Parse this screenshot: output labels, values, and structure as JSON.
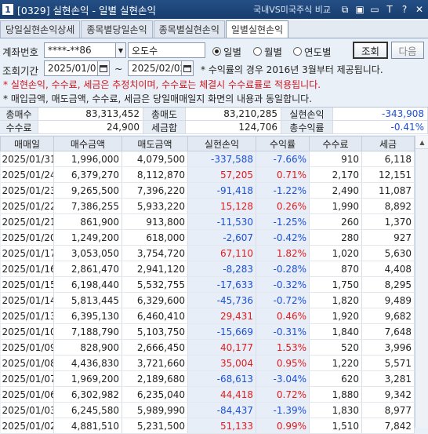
{
  "window": {
    "number": "1",
    "title": "[0329] 실현손익 - 일별 실현손익",
    "compare_link": "국내VS미국주식 비교",
    "icons": [
      "link-icon",
      "copy-icon",
      "minimize-icon",
      "font-icon",
      "help-icon",
      "close-icon"
    ],
    "icon_glyphs": [
      "⧉",
      "▣",
      "▭",
      "T",
      "?",
      "✕"
    ]
  },
  "tabs": [
    "당일실현손익상세",
    "종목별당일손익",
    "종목별실현손익",
    "일별실현손익"
  ],
  "query": {
    "account_label": "계좌번호",
    "account_value": "****-**86",
    "owner_name": "오도수",
    "radios": [
      "일별",
      "월별",
      "연도별"
    ],
    "selected_radio": "일별",
    "search_button": "조회",
    "next_button": "다음",
    "period_label": "조회기간",
    "date_from": "2025/01/01",
    "tilde": "~",
    "date_to": "2025/02/02",
    "yield_note": "* 수익률의 경우 2016년 3월부터 제공됩니다."
  },
  "notices": [
    {
      "text": "* 실현손익, 수수료, 세금은 추정치이며, 수수료는 체결시 수수료률로 적용됩니다.",
      "color": "#d0141e"
    },
    {
      "text": "* 매입금액, 매도금액, 수수료, 세금은 당일매매일지 화면의 내용과 동일합니다.",
      "color": "#222222"
    }
  ],
  "summary": {
    "total_buy_label": "총매수",
    "total_buy": "83,313,452",
    "total_sell_label": "총매도",
    "total_sell": "83,210,285",
    "realized_label": "실현손익",
    "realized": "-343,908",
    "fee_label": "수수료",
    "fee": "24,900",
    "tax_label": "세금합",
    "tax": "124,706",
    "total_yield_label": "총수익률",
    "total_yield": "-0.41%"
  },
  "grid": {
    "columns": [
      "매매일",
      "매수금액",
      "매도금액",
      "실현손익",
      "수익률",
      "수수료",
      "세금"
    ],
    "rows": [
      [
        "2025/01/31",
        "1,996,000",
        "4,079,500",
        "-337,588",
        "-7.66%",
        "910",
        "6,118"
      ],
      [
        "2025/01/24",
        "6,379,270",
        "8,112,870",
        "57,205",
        "0.71%",
        "2,170",
        "12,151"
      ],
      [
        "2025/01/23",
        "9,265,500",
        "7,396,220",
        "-91,418",
        "-1.22%",
        "2,490",
        "11,087"
      ],
      [
        "2025/01/22",
        "7,386,255",
        "5,933,220",
        "15,128",
        "0.26%",
        "1,990",
        "8,892"
      ],
      [
        "2025/01/21",
        "861,900",
        "913,800",
        "-11,530",
        "-1.25%",
        "260",
        "1,370"
      ],
      [
        "2025/01/20",
        "1,249,200",
        "618,000",
        "-2,607",
        "-0.42%",
        "280",
        "927"
      ],
      [
        "2025/01/17",
        "3,053,050",
        "3,754,720",
        "67,110",
        "1.82%",
        "1,020",
        "5,630"
      ],
      [
        "2025/01/16",
        "2,861,470",
        "2,941,120",
        "-8,283",
        "-0.28%",
        "870",
        "4,408"
      ],
      [
        "2025/01/15",
        "6,198,440",
        "5,532,755",
        "-17,633",
        "-0.32%",
        "1,750",
        "8,295"
      ],
      [
        "2025/01/14",
        "5,813,445",
        "6,329,600",
        "-45,736",
        "-0.72%",
        "1,820",
        "9,489"
      ],
      [
        "2025/01/13",
        "6,395,130",
        "6,460,410",
        "29,431",
        "0.46%",
        "1,920",
        "9,682"
      ],
      [
        "2025/01/10",
        "7,188,790",
        "5,103,750",
        "-15,669",
        "-0.31%",
        "1,840",
        "7,648"
      ],
      [
        "2025/01/09",
        "828,900",
        "2,666,450",
        "40,177",
        "1.53%",
        "520",
        "3,996"
      ],
      [
        "2025/01/08",
        "4,436,830",
        "3,721,660",
        "35,004",
        "0.95%",
        "1,220",
        "5,571"
      ],
      [
        "2025/01/07",
        "1,969,200",
        "2,189,680",
        "-68,613",
        "-3.04%",
        "620",
        "3,281"
      ],
      [
        "2025/01/06",
        "6,302,982",
        "6,235,040",
        "44,418",
        "0.72%",
        "1,880",
        "9,342"
      ],
      [
        "2025/01/03",
        "6,245,580",
        "5,989,990",
        "-84,437",
        "-1.39%",
        "1,830",
        "8,977"
      ],
      [
        "2025/01/02",
        "4,881,510",
        "5,231,500",
        "51,133",
        "0.99%",
        "1,510",
        "7,842"
      ]
    ]
  },
  "colors": {
    "positive": "#e21b1b",
    "negative": "#1b4fd8",
    "title_bar": "#1c4477"
  }
}
